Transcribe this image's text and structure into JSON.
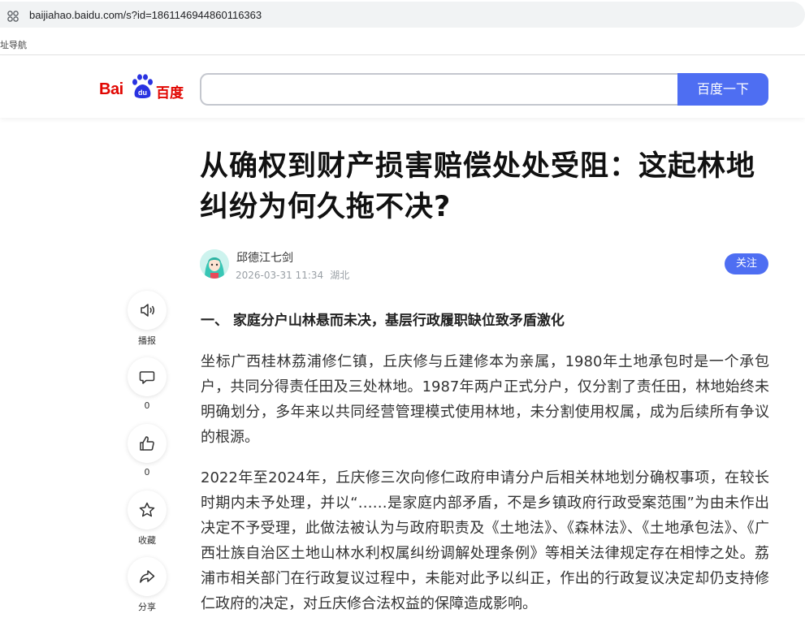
{
  "browser": {
    "url": "baijiahao.baidu.com/s?id=1861146944860116363",
    "bookmark": "址导航"
  },
  "header": {
    "logo_bai": "Bai",
    "logo_du": "du",
    "logo_name": "百度",
    "search_value": "",
    "search_button": "百度一下",
    "accent": "#4e6ef2",
    "brand_red": "#e10601"
  },
  "article": {
    "title": "从确权到财产损害赔偿处处受阻：这起林地纠纷为何久拖不决?",
    "author": "邱德江七剑",
    "datetime": "2026-03-31 11:34",
    "location": "湖北",
    "follow_label": "关注",
    "section_heading": "一、 家庭分户山林悬而未决，基层行政履职缺位致矛盾激化",
    "paragraphs": [
      "坐标广西桂林荔浦修仁镇，丘庆修与丘建修本为亲属，1980年土地承包时是一个承包户，共同分得责任田及三处林地。1987年两户正式分户，仅分割了责任田，林地始终未明确划分，多年来以共同经营管理模式使用林地，未分割使用权属，成为后续所有争议的根源。",
      "2022年至2024年，丘庆修三次向修仁政府申请分户后相关林地划分确权事项，在较长时期内未予处理，并以“……是家庭内部矛盾，不是乡镇政府行政受案范围”为由未作出决定不予受理，此做法被认为与政府职责及《土地法》、《森林法》、《土地承包法》、《广西壮族自治区土地山林水利权属纠纷调解处理条例》等相关法律规定存在相悖之处。荔浦市相关部门在行政复议过程中，未能对此予以纠正，作出的行政复议决定却仍支持修仁政府的决定，对丘庆修合法权益的保障造成影响。"
    ]
  },
  "rail": {
    "items": [
      {
        "icon": "speaker-icon",
        "label": "播报"
      },
      {
        "icon": "comment-icon",
        "label": "0"
      },
      {
        "icon": "thumbs-up-icon",
        "label": "0"
      },
      {
        "icon": "star-icon",
        "label": "收藏"
      },
      {
        "icon": "share-icon",
        "label": "分享"
      }
    ]
  }
}
